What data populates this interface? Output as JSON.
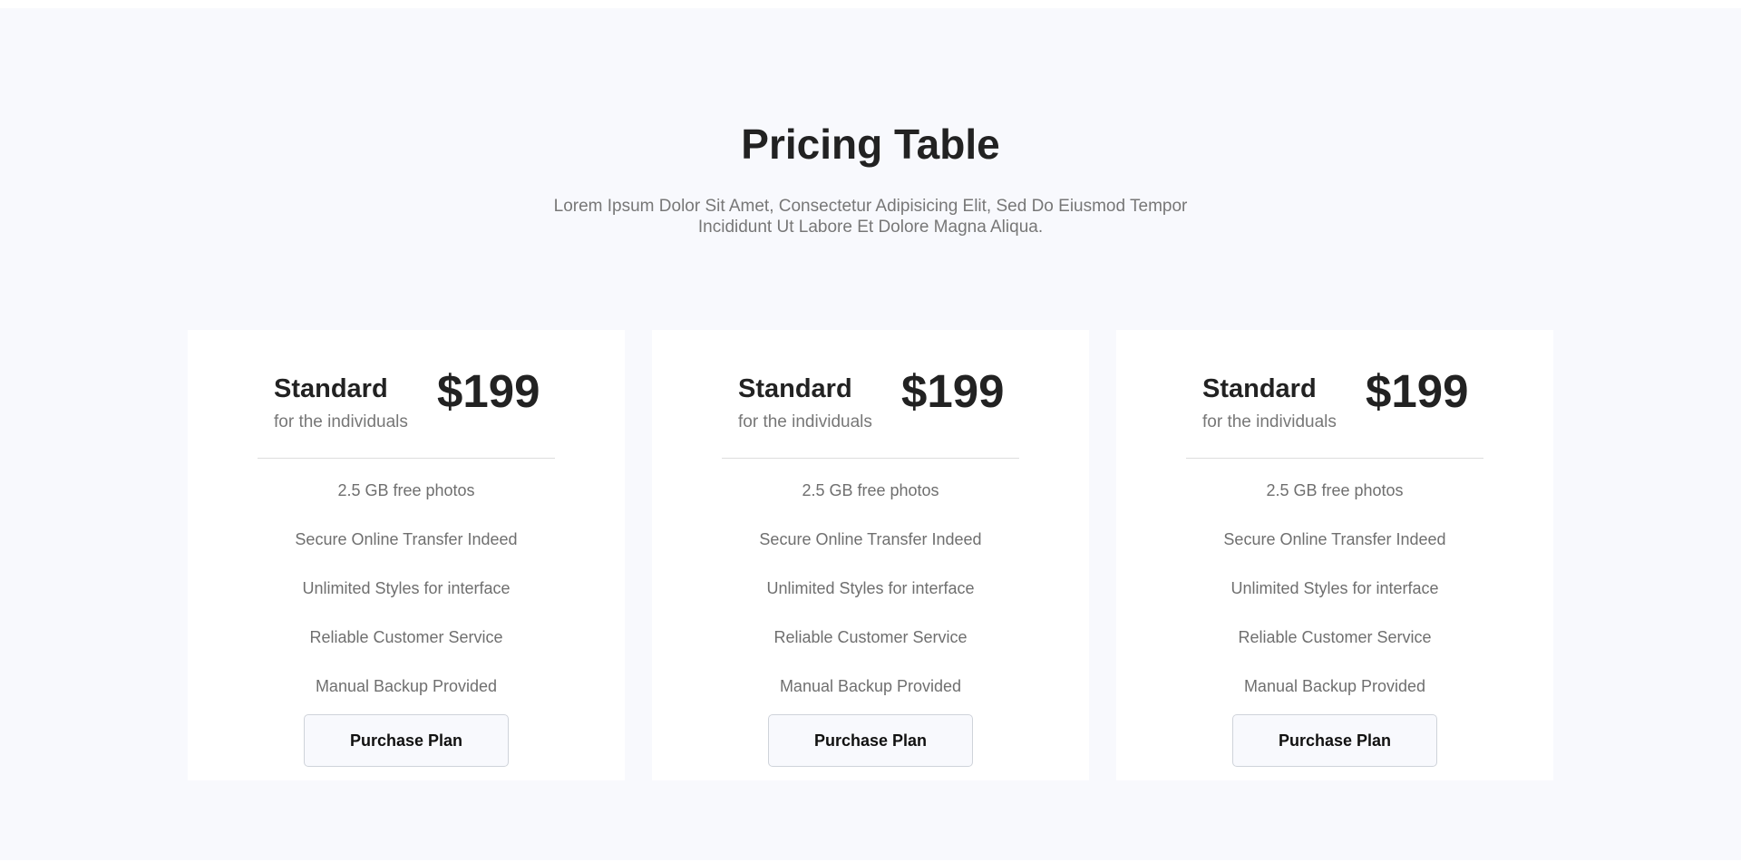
{
  "header": {
    "title": "Pricing Table",
    "subtitle": "Lorem Ipsum Dolor Sit Amet, Consectetur Adipisicing Elit, Sed Do Eiusmod Tempor Incididunt Ut Labore Et Dolore Magna Aliqua."
  },
  "plans": [
    {
      "name": "Standard",
      "description": "for the individuals",
      "price": "$199",
      "features": [
        "2.5 GB free photos",
        "Secure Online Transfer Indeed",
        "Unlimited Styles for interface",
        "Reliable Customer Service",
        "Manual Backup Provided"
      ],
      "button_label": "Purchase Plan"
    },
    {
      "name": "Standard",
      "description": "for the individuals",
      "price": "$199",
      "features": [
        "2.5 GB free photos",
        "Secure Online Transfer Indeed",
        "Unlimited Styles for interface",
        "Reliable Customer Service",
        "Manual Backup Provided"
      ],
      "button_label": "Purchase Plan"
    },
    {
      "name": "Standard",
      "description": "for the individuals",
      "price": "$199",
      "features": [
        "2.5 GB free photos",
        "Secure Online Transfer Indeed",
        "Unlimited Styles for interface",
        "Reliable Customer Service",
        "Manual Backup Provided"
      ],
      "button_label": "Purchase Plan"
    }
  ],
  "colors": {
    "background": "#f8f9fd",
    "card": "#ffffff",
    "heading": "#222222",
    "muted_text": "#777777"
  }
}
